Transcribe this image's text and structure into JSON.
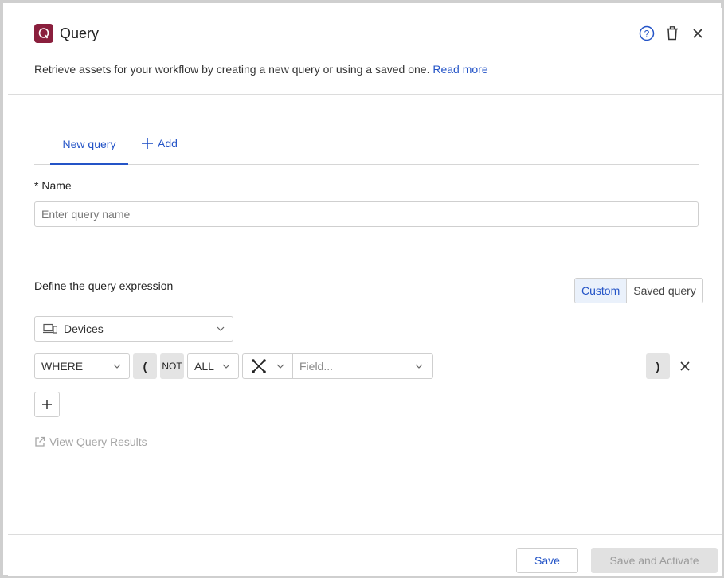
{
  "header": {
    "title": "Query",
    "subtitle": "Retrieve assets for your workflow by creating a new query or using a saved one.",
    "read_more": "Read more",
    "brand_color": "#8a1f3d",
    "icons": [
      "help-icon",
      "trash-icon",
      "close-icon"
    ]
  },
  "tabs": {
    "new_query": "New query",
    "add": "Add"
  },
  "form": {
    "name_label": "* Name",
    "name_placeholder": "Enter query name",
    "expression_label": "Define the query expression",
    "mode_options": [
      "Custom",
      "Saved query"
    ],
    "mode_selected": "Custom",
    "asset_type": "Devices"
  },
  "expression_row": {
    "where": "WHERE",
    "open_paren": "(",
    "not": "NOT",
    "all": "ALL",
    "field_placeholder": "Field...",
    "close_paren": ")"
  },
  "view_results": "View Query Results",
  "footer": {
    "save": "Save",
    "save_activate": "Save and Activate"
  },
  "colors": {
    "accent": "#2454c7",
    "disabled_text": "#9c9c9c"
  }
}
